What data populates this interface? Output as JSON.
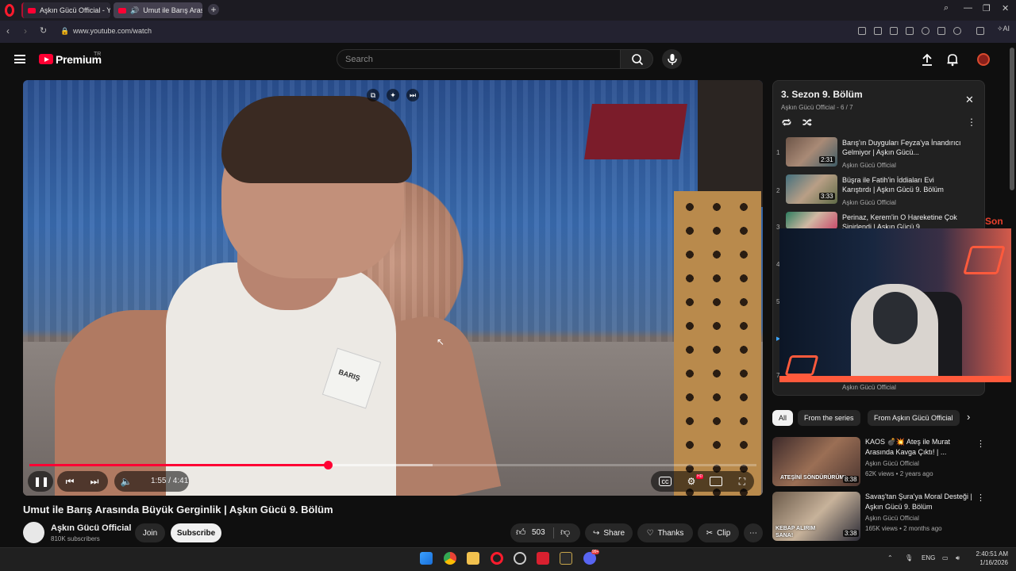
{
  "browser": {
    "tabs": [
      {
        "label": "Aşkın Gücü Official - YouT"
      },
      {
        "label": "Umut ile Barış Arasında"
      }
    ],
    "url": "www.youtube.com/watch",
    "ai_label": "AI"
  },
  "header": {
    "brand": "Premium",
    "region": "TR",
    "search_placeholder": "Search"
  },
  "video": {
    "time_current": "1:55",
    "time_total": "4:41",
    "time_display": "1:55 / 4:41",
    "progress_fraction": 0.41,
    "buffered_fraction": 0.555,
    "badge_text": "BARIŞ",
    "hd_badge": "HD",
    "title": "Umut ile Barış Arasında Büyük Gerginlik | Aşkın Gücü 9. Bölüm"
  },
  "owner": {
    "channel": "Aşkın Gücü Official",
    "subscribers": "810K subscribers",
    "join_label": "Join",
    "subscribe_label": "Subscribe"
  },
  "actions": {
    "likes": "503",
    "share": "Share",
    "thanks": "Thanks",
    "clip": "Clip"
  },
  "playlist": {
    "title": "3. Sezon 9. Bölüm",
    "subtitle": "Aşkın Gücü Official - 6 / 7",
    "items": [
      {
        "num": "1",
        "title": "Barış'ın Duyguları Feyza'ya İnandırıcı Gelmiyor | Aşkın Gücü...",
        "channel": "Aşkın Gücü Official",
        "duration": "2:31"
      },
      {
        "num": "2",
        "title": "Büşra ile Fatih'in İddiaları Evi Karıştırdı | Aşkın Gücü 9. Bölüm",
        "channel": "Aşkın Gücü Official",
        "duration": "3:33"
      },
      {
        "num": "3",
        "title": "Perinaz, Kerem'in O Hareketine Çok Sinirlendi | Aşkın Gücü 9...",
        "channel": "",
        "duration": ""
      }
    ],
    "hidden_nums": [
      "4",
      "5",
      "7"
    ],
    "last_channel": "Aşkın Gücü Official"
  },
  "overlay_text": "Son",
  "chips": [
    "All",
    "From the series",
    "From Aşkın Gücü Official"
  ],
  "recommendations": [
    {
      "title": "KAOS 💣💥 Ateş ile Murat Arasında Kavga Çıktı! | ...",
      "channel": "Aşkın Gücü Official",
      "meta": "62K views • 2 years ago",
      "duration": "8:38",
      "caption": "ATEŞİNİ SÖNDÜRÜRÜM!"
    },
    {
      "title": "Savaş'tan Şura'ya Moral Desteği | Aşkın Gücü 9. Bölüm",
      "channel": "Aşkın Gücü Official",
      "meta": "165K views • 2 months ago",
      "duration": "3:38",
      "caption": "KEBAP ALIRIM SANA!"
    }
  ],
  "taskbar": {
    "lang": "ENG",
    "time": "2:40:51 AM",
    "date": "1/16/2026",
    "notification_badge": "99+"
  },
  "colors": {
    "accent_red": "#ff0033",
    "background": "#0f0f0f",
    "overlay_orange": "#ff5a3c"
  }
}
